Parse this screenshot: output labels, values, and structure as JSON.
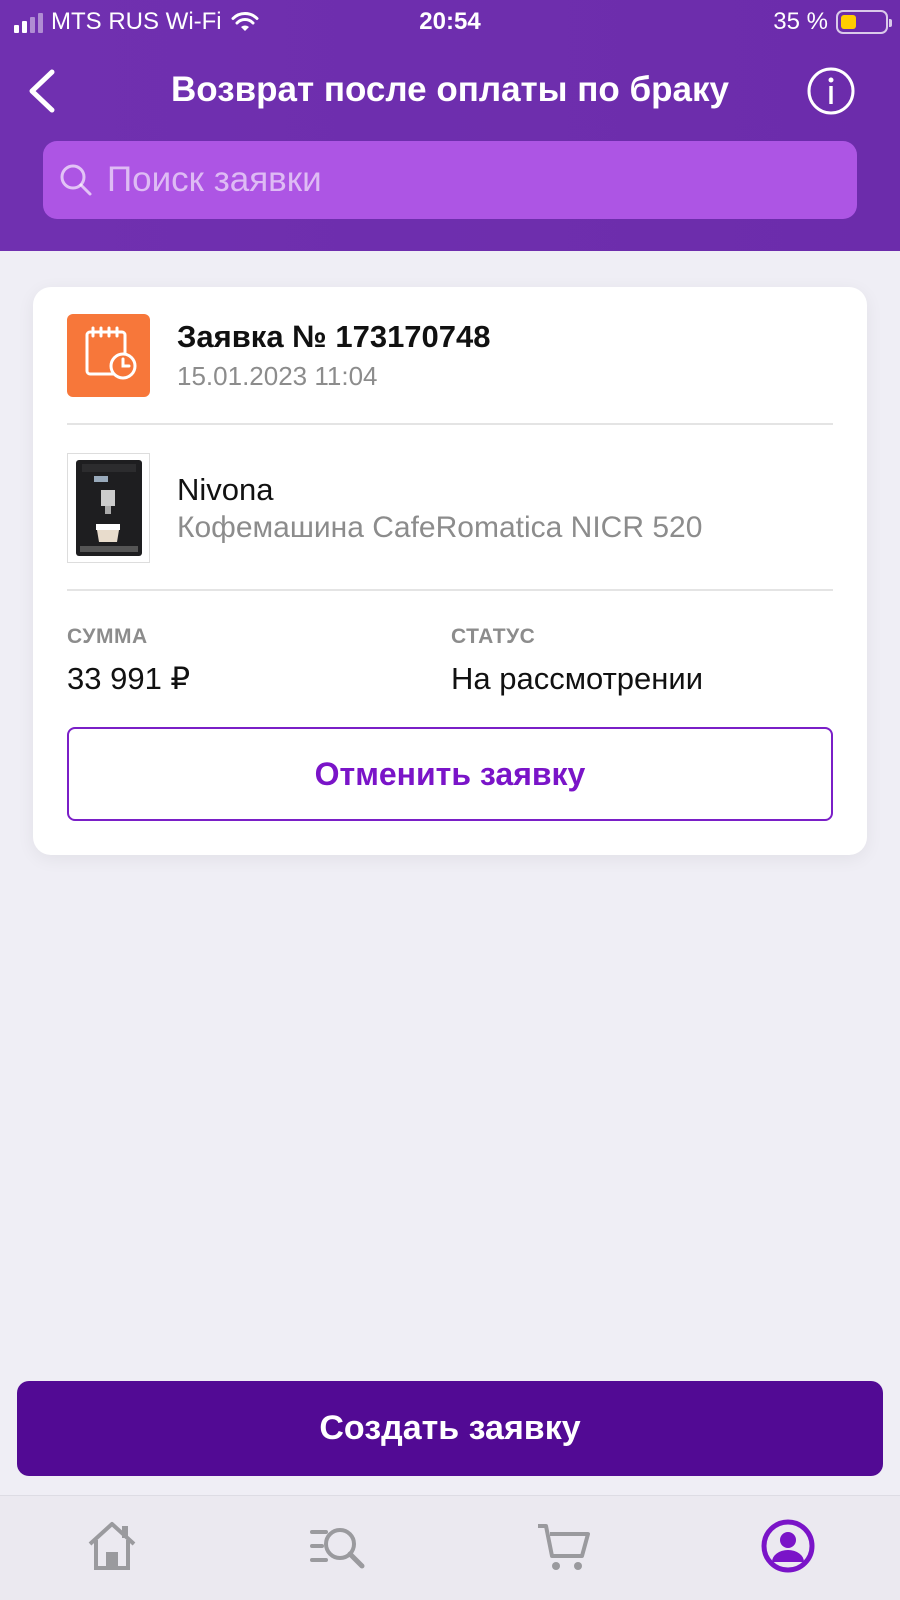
{
  "status_bar": {
    "carrier": "MTS RUS Wi-Fi",
    "time": "20:54",
    "battery_percent": "35 %",
    "battery_level": 0.35
  },
  "header": {
    "title": "Возврат после оплаты по браку",
    "back_icon": "chevron-left-icon",
    "info_icon": "info-icon"
  },
  "search": {
    "placeholder": "Поиск заявки",
    "value": ""
  },
  "card": {
    "order_title": "Заявка № 173170748",
    "order_date": "15.01.2023 11:04",
    "product_brand": "Nivona",
    "product_name": "Кофемашина CafeRomatica NICR 520",
    "sum_label": "СУММА",
    "sum_value": "33 991 ₽",
    "status_label": "СТАТУС",
    "status_value": "На рассмотрении",
    "cancel_label": "Отменить заявку"
  },
  "create_label": "Создать заявку",
  "tabbar": {
    "items": [
      "home-icon",
      "catalog-search-icon",
      "cart-icon",
      "profile-icon"
    ],
    "active": "profile-icon"
  },
  "colors": {
    "header": "#6c2cab",
    "search_bg": "#ad55e4",
    "accent": "#7a14c8",
    "create_button": "#520a94",
    "order_icon": "#f7773a"
  }
}
